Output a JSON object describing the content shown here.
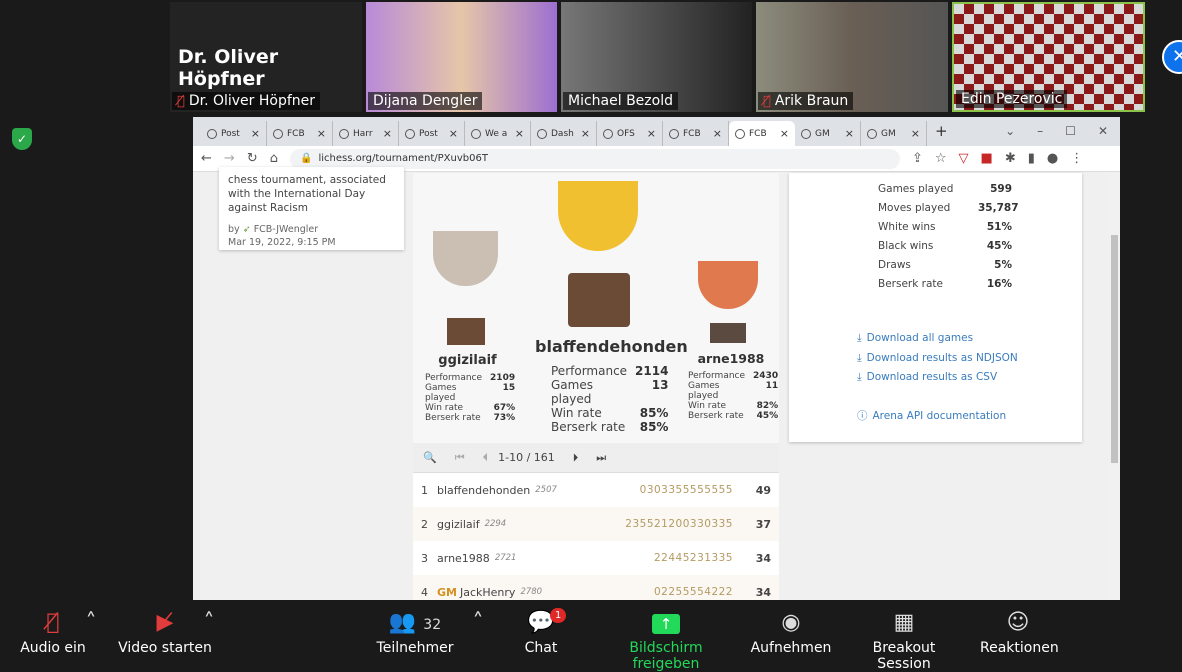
{
  "participants": [
    {
      "name": "Dr. Oliver Höpfner",
      "muted": true
    },
    {
      "name": "Dijana Dengler",
      "muted": false
    },
    {
      "name": "Michael Bezold",
      "muted": false
    },
    {
      "name": "Arik Braun",
      "muted": true
    },
    {
      "name": "Edin Pezerovic",
      "muted": false,
      "active_speaker": true
    }
  ],
  "browser": {
    "tabs": [
      "Post",
      "FCB",
      "Harr",
      "Post",
      "We a",
      "Dash",
      "OFS",
      "FCB",
      "FCB",
      "GM",
      "GM"
    ],
    "active_tab": 8,
    "url": "lichess.org/tournament/PXuvb06T"
  },
  "card": {
    "description": "chess tournament, associated with the International Day against Racism",
    "by": "by",
    "author": "FCB-JWengler",
    "date": "Mar 19, 2022, 9:15 PM"
  },
  "podium": {
    "labels": {
      "performance": "Performance",
      "games": "Games played",
      "win": "Win rate",
      "berserk": "Berserk rate"
    },
    "first": {
      "name": "blaffendehonden",
      "performance": "2114",
      "games": "13",
      "win": "85%",
      "berserk": "85%"
    },
    "second": {
      "name": "ggizilaif",
      "performance": "2109",
      "games": "15",
      "win": "67%",
      "berserk": "73%"
    },
    "third": {
      "name": "arne1988",
      "performance": "2430",
      "games": "11",
      "win": "82%",
      "berserk": "45%"
    }
  },
  "pager": {
    "range": "1-10 / 161"
  },
  "standings": [
    {
      "rank": "1",
      "title": "",
      "name": "blaffendehonden",
      "rating": "2507",
      "scores": "0303355555555",
      "total": "49"
    },
    {
      "rank": "2",
      "title": "",
      "name": "ggizilaif",
      "rating": "2294",
      "scores": "235521200330335",
      "total": "37"
    },
    {
      "rank": "3",
      "title": "",
      "name": "arne1988",
      "rating": "2721",
      "scores": "22445231335",
      "total": "34"
    },
    {
      "rank": "4",
      "title": "GM",
      "name": "JackHenry",
      "rating": "2780",
      "scores": "02255554222",
      "total": "34"
    }
  ],
  "stats": [
    {
      "label": "Games played",
      "value": "599"
    },
    {
      "label": "Moves played",
      "value": "35,787"
    },
    {
      "label": "White wins",
      "value": "51%"
    },
    {
      "label": "Black wins",
      "value": "45%"
    },
    {
      "label": "Draws",
      "value": "5%"
    },
    {
      "label": "Berserk rate",
      "value": "16%"
    }
  ],
  "links": [
    "Download all games",
    "Download results as NDJSON",
    "Download results as CSV",
    "Arena API documentation"
  ],
  "zoombar": {
    "audio": "Audio ein",
    "video": "Video starten",
    "participants": "Teilnehmer",
    "participants_count": "32",
    "chat": "Chat",
    "chat_badge": "1",
    "share": "Bildschirm freigeben",
    "record": "Aufnehmen",
    "breakout": "Breakout Session",
    "reactions": "Reaktionen"
  },
  "colors": {
    "share": "#23d959",
    "accent": "#0e72ed",
    "active_speaker": "#8bc34a"
  }
}
